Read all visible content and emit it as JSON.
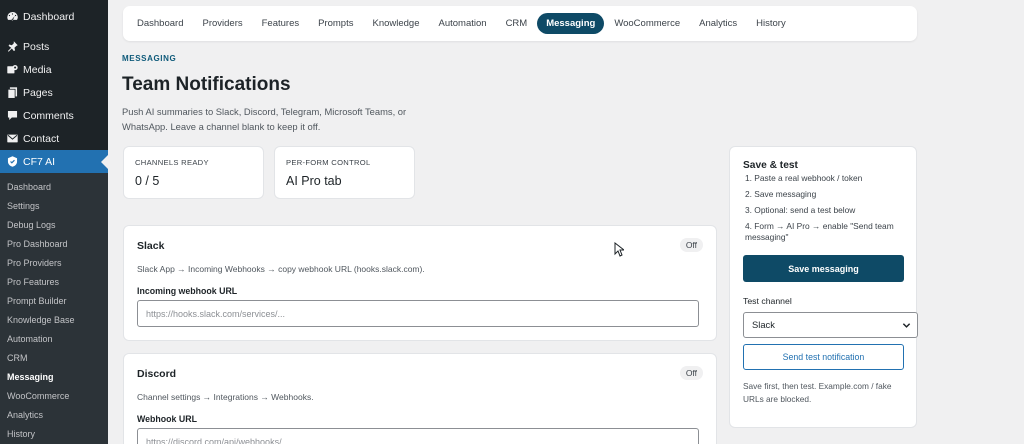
{
  "sidebar": {
    "top_items": [
      {
        "label": "Dashboard",
        "icon": "dashboard-icon"
      },
      {
        "label": "Posts",
        "icon": "pin-icon"
      },
      {
        "label": "Media",
        "icon": "media-icon"
      },
      {
        "label": "Pages",
        "icon": "pages-icon"
      },
      {
        "label": "Comments",
        "icon": "comment-icon"
      },
      {
        "label": "Contact",
        "icon": "mail-icon"
      },
      {
        "label": "CF7 AI",
        "icon": "shield-icon"
      }
    ],
    "sub_items": [
      "Dashboard",
      "Settings",
      "Debug Logs",
      "Pro Dashboard",
      "Pro Providers",
      "Pro Features",
      "Prompt Builder",
      "Knowledge Base",
      "Automation",
      "CRM",
      "Messaging",
      "WooCommerce",
      "Analytics",
      "History"
    ]
  },
  "topnav": {
    "tabs": [
      "Dashboard",
      "Providers",
      "Features",
      "Prompts",
      "Knowledge",
      "Automation",
      "CRM",
      "Messaging",
      "WooCommerce",
      "Analytics",
      "History"
    ],
    "active": "Messaging"
  },
  "header": {
    "eyebrow": "MESSAGING",
    "title": "Team Notifications",
    "description": "Push AI summaries to Slack, Discord, Telegram, Microsoft Teams, or WhatsApp. Leave a channel blank to keep it off."
  },
  "stats": [
    {
      "label": "CHANNELS READY",
      "value": "0 / 5"
    },
    {
      "label": "PER-FORM CONTROL",
      "value": "AI Pro tab"
    }
  ],
  "channels": {
    "slack": {
      "title": "Slack",
      "status": "Off",
      "help": "Slack App → Incoming Webhooks → copy webhook URL (hooks.slack.com).",
      "field_label": "Incoming webhook URL",
      "placeholder": "https://hooks.slack.com/services/...",
      "value": ""
    },
    "discord": {
      "title": "Discord",
      "status": "Off",
      "help": "Channel settings → Integrations → Webhooks.",
      "field_label": "Webhook URL",
      "placeholder": "https://discord.com/api/webhooks/...",
      "value": ""
    }
  },
  "side_panel": {
    "title": "Save & test",
    "steps": [
      "1. Paste a real webhook / token",
      "2. Save messaging",
      "3. Optional: send a test below",
      "4. Form → AI Pro → enable \"Send team messaging\""
    ],
    "save_label": "Save messaging",
    "test_channel_label": "Test channel",
    "test_channel_value": "Slack",
    "send_test_label": "Send test notification",
    "note": "Save first, then test. Example.com / fake URLs are blocked."
  },
  "colors": {
    "accent": "#0e4a66",
    "wp_blue": "#2271b1",
    "sidebar_bg": "#1d2327"
  }
}
